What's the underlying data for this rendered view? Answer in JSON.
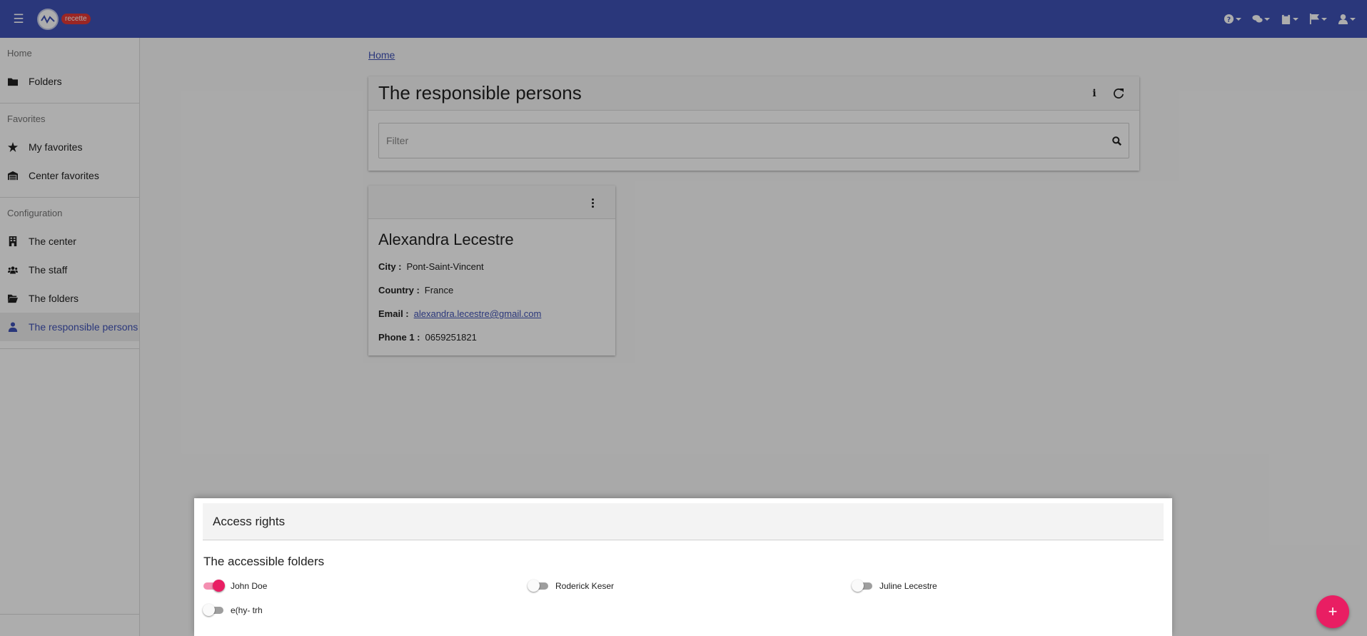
{
  "app": {
    "env_badge": "recette"
  },
  "topbar": {
    "icons": [
      "help-icon",
      "chat-icon",
      "clipboard-icon",
      "flag-icon",
      "user-icon"
    ]
  },
  "sidebar": {
    "home_heading": "Home",
    "folders_label": "Folders",
    "favorites_heading": "Favorites",
    "my_favorites_label": "My favorites",
    "center_favorites_label": "Center favorites",
    "configuration_heading": "Configuration",
    "the_center_label": "The center",
    "the_staff_label": "The staff",
    "the_folders_label": "The folders",
    "responsible_persons_label": "The responsible persons"
  },
  "breadcrumb": {
    "home": "Home"
  },
  "page": {
    "title": "The responsible persons",
    "filter_placeholder": "Filter"
  },
  "person": {
    "name": "Alexandra Lecestre",
    "city_label": "City :",
    "city": "Pont-Saint-Vincent",
    "country_label": "Country :",
    "country": "France",
    "email_label": "Email :",
    "email": "alexandra.lecestre@gmail.com",
    "phone_label": "Phone 1 :",
    "phone": "0659251821"
  },
  "access": {
    "title": "Access rights",
    "subtitle": "The accessible folders",
    "folders": [
      {
        "name": "John Doe",
        "enabled": true
      },
      {
        "name": "Roderick Keser",
        "enabled": false
      },
      {
        "name": "Juline Lecestre",
        "enabled": false
      },
      {
        "name": "e(hy- trh",
        "enabled": false
      }
    ]
  },
  "fab": {
    "label": "+"
  },
  "colors": {
    "primary": "#3f51b5",
    "accent": "#e91e63",
    "badge": "#e53935"
  }
}
